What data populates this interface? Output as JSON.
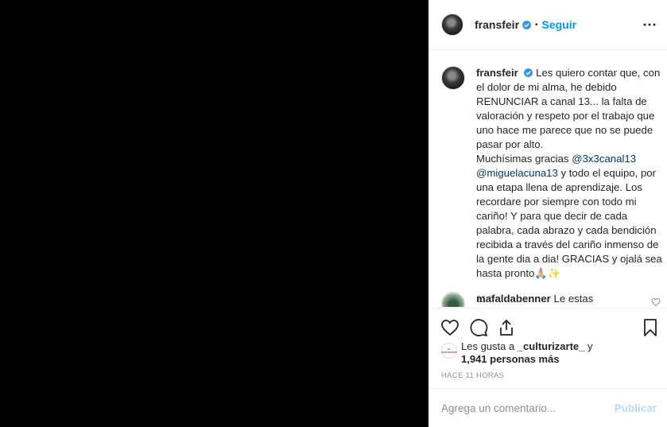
{
  "colors": {
    "accent": "#0095f6",
    "mention": "#00376b",
    "muted": "#8e8e8e",
    "publish_disabled": "#b3dbff"
  },
  "header": {
    "username": "fransfeir",
    "separator": "•",
    "follow_label": "Seguir",
    "more_icon": "more-horizontal-icon"
  },
  "caption": {
    "username": "fransfeir",
    "text_part1": "Les quiero contar que, con el dolor de mi alma, he debido RENUNCIAR a canal 13... la falta de valoración y respeto por el trabajo que uno hace me parece que no se puede pasar por alto.",
    "text_part2": "Muchísimas gracias ",
    "mention1": "@3x3canal13",
    "mention2": "@miguelacuna13",
    "text_part3": " y todo el equipo, por una etapa llena de aprendizaje. Los recordare por siempre con todo mi cariño! Y para que decir de cada palabra, cada abrazo y cada bendición recibida a través del cariño inmenso de la gente dia a dia! GRACIAS y ojalá sea hasta pronto🙏🏼✨",
    "time": "11 h"
  },
  "comment": {
    "username": "mafaldabenner",
    "text": "Le estas"
  },
  "actions": {
    "like_icon": "heart-icon",
    "comment_icon": "comment-icon",
    "share_icon": "share-icon",
    "save_icon": "bookmark-icon"
  },
  "likes": {
    "prefix": "Les gusta a ",
    "user": "_culturizarte_",
    "middle": " y",
    "count": "1,941 personas más",
    "avatar_text": "EL MOSTRADOR"
  },
  "timestamp": "Hace 11 horas",
  "comment_box": {
    "placeholder": "Agrega un comentario...",
    "publish_label": "Publicar"
  }
}
